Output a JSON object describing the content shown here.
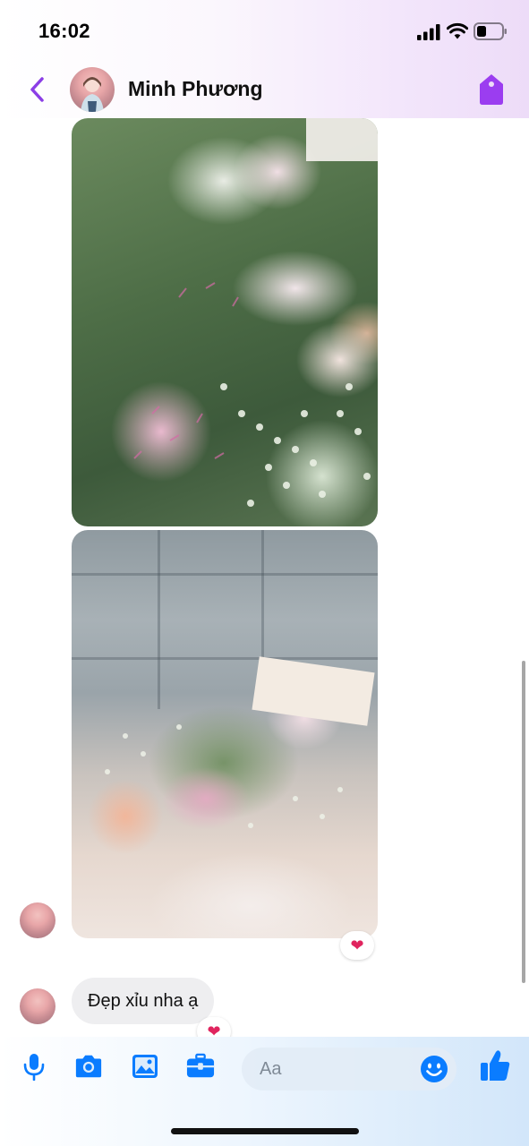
{
  "status_bar": {
    "time": "16:02",
    "icons": [
      "signal-icon",
      "wifi-icon",
      "battery-icon"
    ]
  },
  "header": {
    "contact_name": "Minh Phương",
    "icons": [
      "back-chevron-icon",
      "tag-icon"
    ]
  },
  "messages": [
    {
      "type": "image",
      "description_icon": "photo"
    },
    {
      "type": "image",
      "description_icon": "photo",
      "reaction": "❤️"
    },
    {
      "type": "text",
      "text": "Đẹp xỉu nha ạ",
      "reaction": "❤️"
    }
  ],
  "composer": {
    "placeholder": "Aa",
    "icons": [
      "microphone-icon",
      "camera-icon",
      "gallery-icon",
      "briefcase-icon",
      "emoji-icon",
      "thumbs-up-icon"
    ]
  },
  "colors": {
    "accent_purple": "#9b3df0",
    "accent_blue": "#0a7cff",
    "bubble_gray": "#eeeef0"
  }
}
